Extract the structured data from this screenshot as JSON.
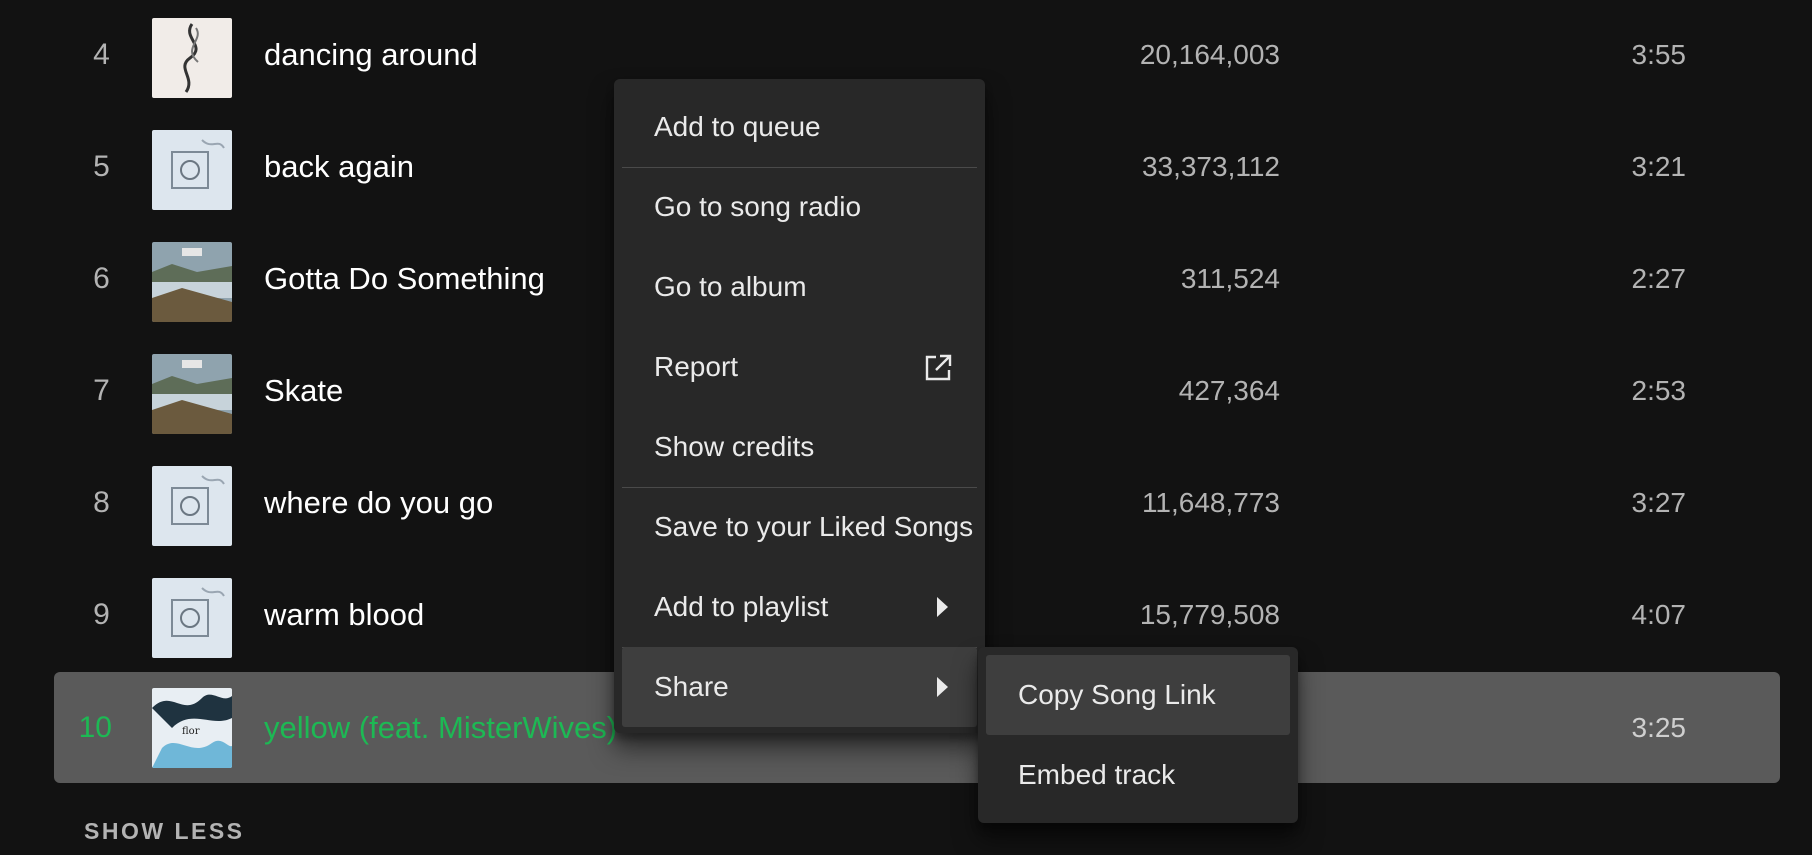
{
  "tracks": [
    {
      "number": "4",
      "title": "dancing around",
      "plays": "20,164,003",
      "duration": "3:55",
      "cover": "dancing-around-cover"
    },
    {
      "number": "5",
      "title": "back again",
      "plays": "33,373,112",
      "duration": "3:21",
      "cover": "sketch-album-cover"
    },
    {
      "number": "6",
      "title": "Gotta Do Something",
      "plays": "311,524",
      "duration": "2:27",
      "cover": "lake-album-cover"
    },
    {
      "number": "7",
      "title": "Skate",
      "plays": "427,364",
      "duration": "2:53",
      "cover": "lake-album-cover"
    },
    {
      "number": "8",
      "title": "where do you go",
      "plays": "11,648,773",
      "duration": "3:27",
      "cover": "sketch-album-cover"
    },
    {
      "number": "9",
      "title": "warm blood",
      "plays": "15,779,508",
      "duration": "4:07",
      "cover": "sketch-album-cover"
    },
    {
      "number": "10",
      "title": "yellow (feat. MisterWives)",
      "plays": "",
      "duration": "3:25",
      "cover": "yellow-cover",
      "selected": true
    }
  ],
  "show_less_label": "SHOW LESS",
  "context_menu": {
    "items": [
      {
        "label": "Add to queue"
      },
      {
        "label": "Go to song radio"
      },
      {
        "label": "Go to album"
      },
      {
        "label": "Report",
        "icon": "external-link-icon"
      },
      {
        "label": "Show credits"
      },
      {
        "label": "Save to your Liked Songs"
      },
      {
        "label": "Add to playlist",
        "icon": "chevron-right-icon"
      },
      {
        "label": "Share",
        "icon": "chevron-right-icon",
        "active": true
      }
    ]
  },
  "share_submenu": {
    "items": [
      {
        "label": "Copy Song Link",
        "active": true
      },
      {
        "label": "Embed track"
      }
    ]
  },
  "colors": {
    "background": "#121212",
    "accent_green": "#1db954",
    "menu_bg": "#282828",
    "menu_hover": "#3e3e3e",
    "selected_row": "#5a5a5a"
  }
}
